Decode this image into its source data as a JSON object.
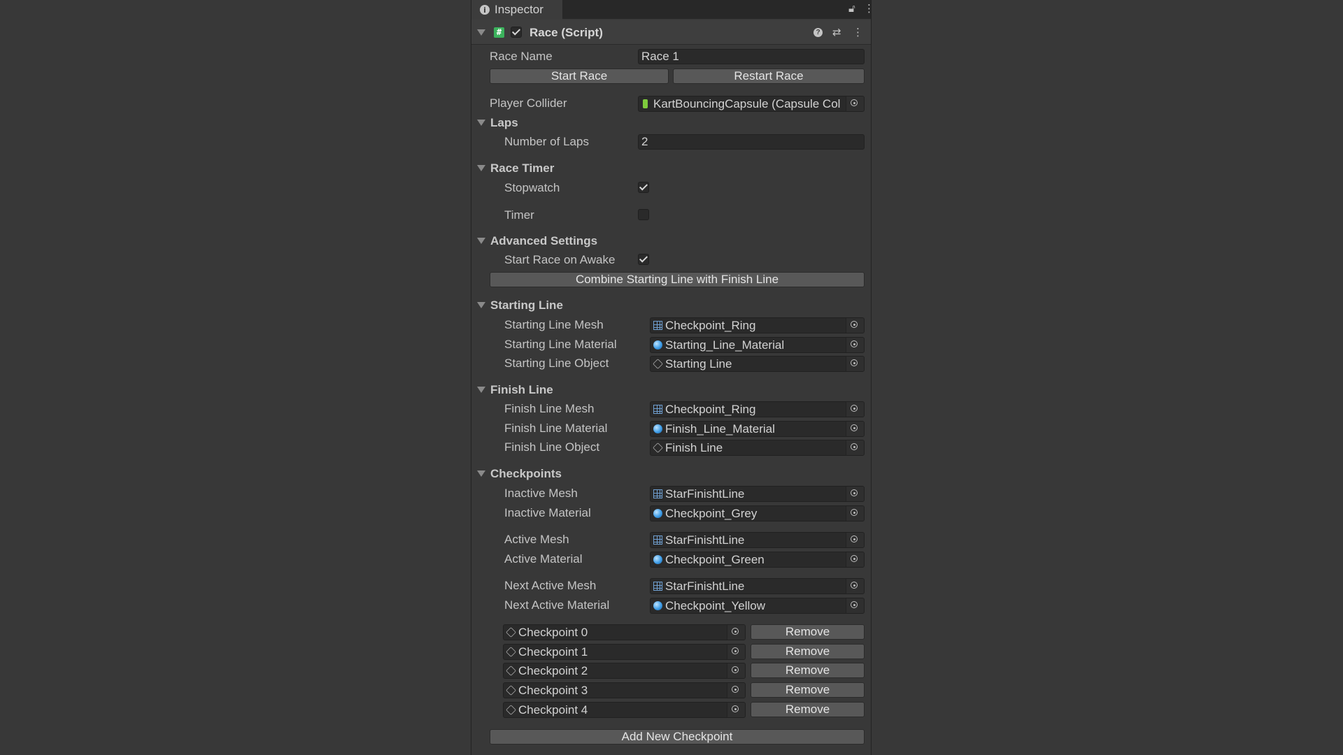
{
  "tab": {
    "title": "Inspector",
    "lock_icon": "lock-icon",
    "menu_icon": "kebab-menu-icon"
  },
  "component": {
    "title": "Race (Script)",
    "enabled": true,
    "icons": [
      "help-icon",
      "preset-icon",
      "kebab-menu-icon"
    ]
  },
  "race_name": {
    "label": "Race Name",
    "value": "Race 1"
  },
  "buttons": {
    "start_race": "Start Race",
    "restart_race": "Restart Race",
    "combine": "Combine Starting Line with Finish Line",
    "add_checkpoint": "Add New Checkpoint"
  },
  "player_collider": {
    "label": "Player Collider",
    "value": "KartBouncingCapsule (Capsule Col"
  },
  "laps": {
    "section": "Laps",
    "label": "Number of Laps",
    "value": "2"
  },
  "race_timer": {
    "section": "Race Timer",
    "stopwatch": {
      "label": "Stopwatch",
      "checked": true
    },
    "timer": {
      "label": "Timer",
      "checked": false
    }
  },
  "advanced": {
    "section": "Advanced Settings",
    "start_on_awake": {
      "label": "Start Race on Awake",
      "checked": true
    }
  },
  "starting_line": {
    "section": "Starting Line",
    "mesh": {
      "label": "Starting Line Mesh",
      "value": "Checkpoint_Ring"
    },
    "material": {
      "label": "Starting Line Material",
      "value": "Starting_Line_Material"
    },
    "object": {
      "label": "Starting Line Object",
      "value": "Starting Line"
    }
  },
  "finish_line": {
    "section": "Finish Line",
    "mesh": {
      "label": "Finish Line Mesh",
      "value": "Checkpoint_Ring"
    },
    "material": {
      "label": "Finish Line Material",
      "value": "Finish_Line_Material"
    },
    "object": {
      "label": "Finish Line Object",
      "value": "Finish Line"
    }
  },
  "checkpoints": {
    "section": "Checkpoints",
    "inactive_mesh": {
      "label": "Inactive Mesh",
      "value": "StarFinishtLine"
    },
    "inactive_material": {
      "label": "Inactive Material",
      "value": "Checkpoint_Grey"
    },
    "active_mesh": {
      "label": "Active Mesh",
      "value": "StarFinishtLine"
    },
    "active_material": {
      "label": "Active Material",
      "value": "Checkpoint_Green"
    },
    "next_active_mesh": {
      "label": "Next Active Mesh",
      "value": "StarFinishtLine"
    },
    "next_active_material": {
      "label": "Next Active Material",
      "value": "Checkpoint_Yellow"
    },
    "remove_label": "Remove",
    "list": [
      "Checkpoint 0",
      "Checkpoint 1",
      "Checkpoint 2",
      "Checkpoint 3",
      "Checkpoint 4"
    ]
  }
}
